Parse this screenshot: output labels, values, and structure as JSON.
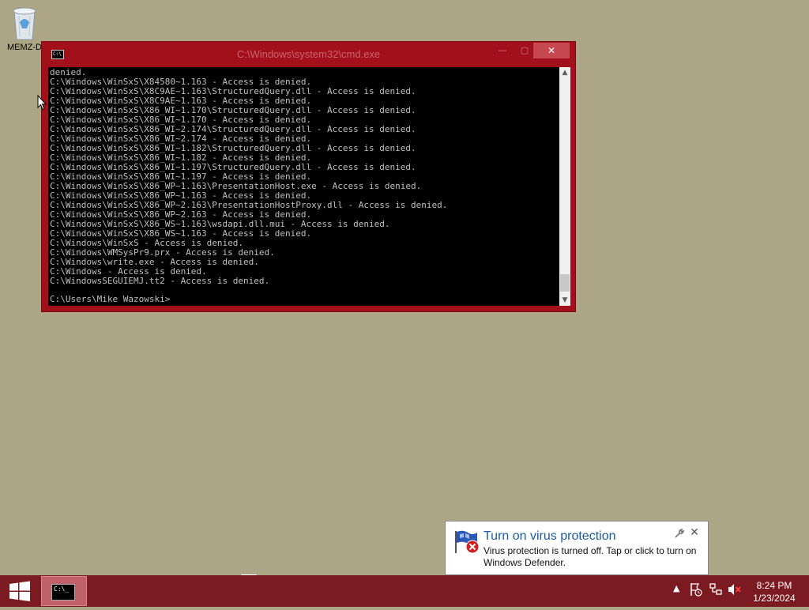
{
  "desktop": {
    "icon_label": "MEMZ-D"
  },
  "cmd_window": {
    "title": "C:\\Windows\\system32\\cmd.exe",
    "minimize_label": "—",
    "maximize_label": "▢",
    "close_label": "✕",
    "lines": [
      "denied.",
      "C:\\Windows\\WinSxS\\X84580~1.163 - Access is denied.",
      "C:\\Windows\\WinSxS\\X8C9AE~1.163\\StructuredQuery.dll - Access is denied.",
      "C:\\Windows\\WinSxS\\X8C9AE~1.163 - Access is denied.",
      "C:\\Windows\\WinSxS\\X86_WI~1.170\\StructuredQuery.dll - Access is denied.",
      "C:\\Windows\\WinSxS\\X86_WI~1.170 - Access is denied.",
      "C:\\Windows\\WinSxS\\X86_WI~2.174\\StructuredQuery.dll - Access is denied.",
      "C:\\Windows\\WinSxS\\X86_WI~2.174 - Access is denied.",
      "C:\\Windows\\WinSxS\\X86_WI~1.182\\StructuredQuery.dll - Access is denied.",
      "C:\\Windows\\WinSxS\\X86_WI~1.182 - Access is denied.",
      "C:\\Windows\\WinSxS\\X86_WI~1.197\\StructuredQuery.dll - Access is denied.",
      "C:\\Windows\\WinSxS\\X86_WI~1.197 - Access is denied.",
      "C:\\Windows\\WinSxS\\X86_WP~1.163\\PresentationHost.exe - Access is denied.",
      "C:\\Windows\\WinSxS\\X86_WP~1.163 - Access is denied.",
      "C:\\Windows\\WinSxS\\X86_WP~2.163\\PresentationHostProxy.dll - Access is denied.",
      "C:\\Windows\\WinSxS\\X86_WP~2.163 - Access is denied.",
      "C:\\Windows\\WinSxS\\X86_WS~1.163\\wsdapi.dll.mui - Access is denied.",
      "C:\\Windows\\WinSxS\\X86_WS~1.163 - Access is denied.",
      "C:\\Windows\\WinSxS - Access is denied.",
      "C:\\Windows\\WMSysPr9.prx - Access is denied.",
      "C:\\Windows\\write.exe - Access is denied.",
      "C:\\Windows - Access is denied.",
      "C:\\WindowsSEGUIEMJ.tt2 - Access is denied."
    ],
    "prompt": "C:\\Users\\Mike Wazowski>"
  },
  "notification": {
    "title": "Turn on virus protection",
    "body": "Virus protection is turned off. Tap or click to turn on Windows Defender."
  },
  "taskbar": {
    "task_icon_text": "C:\\_",
    "time": "8:24 PM",
    "date": "1/23/2024"
  },
  "colors": {
    "desktop": "#ADA686",
    "window_frame": "#A2101C",
    "taskbar": "#7C1A22",
    "notification_title": "#1c5aa8"
  }
}
